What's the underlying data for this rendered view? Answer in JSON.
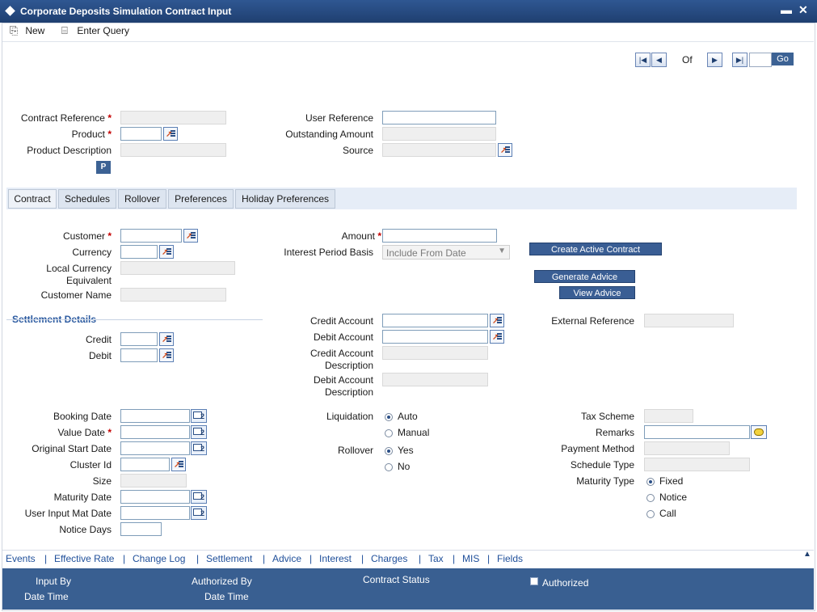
{
  "window": {
    "title": "Corporate Deposits Simulation Contract Input",
    "minimize": "▬",
    "close": "✕"
  },
  "toolbar": {
    "new_label": "New",
    "enter_query_label": "Enter Query"
  },
  "pager": {
    "of_label": "Of",
    "go_label": "Go",
    "first": "|◀",
    "prev": "◀",
    "next": "▶",
    "last": "▶|"
  },
  "header": {
    "contract_reference": "Contract Reference",
    "product": "Product",
    "product_description": "Product Description",
    "p_button": "P",
    "user_reference": "User Reference",
    "outstanding_amount": "Outstanding Amount",
    "source": "Source",
    "required_mark": "*"
  },
  "tabs": [
    {
      "label": "Contract"
    },
    {
      "label": "Schedules"
    },
    {
      "label": "Rollover"
    },
    {
      "label": "Preferences"
    },
    {
      "label": "Holiday Preferences"
    }
  ],
  "contract": {
    "customer": "Customer",
    "currency": "Currency",
    "local_currency_equivalent_1": "Local Currency",
    "local_currency_equivalent_2": "Equivalent",
    "customer_name": "Customer Name",
    "amount": "Amount",
    "interest_period_basis": "Interest Period Basis",
    "interest_period_basis_value": "Include From Date",
    "create_active_contract": "Create Active Contract",
    "generate_advice": "Generate Advice",
    "view_advice": "View Advice"
  },
  "settlement": {
    "title": "Settlement Details",
    "credit": "Credit",
    "debit": "Debit",
    "credit_account": "Credit Account",
    "debit_account": "Debit Account",
    "credit_account_description_1": "Credit Account",
    "credit_account_description_2": "Description",
    "debit_account_description_1": "Debit Account",
    "debit_account_description_2": "Description",
    "external_reference": "External Reference"
  },
  "dates": {
    "booking_date": "Booking Date",
    "value_date": "Value Date",
    "original_start_date": "Original Start Date",
    "cluster_id": "Cluster Id",
    "size": "Size",
    "maturity_date": "Maturity Date",
    "user_input_mat_date": "User Input Mat Date",
    "notice_days": "Notice Days"
  },
  "options": {
    "liquidation": "Liquidation",
    "liquidation_auto": "Auto",
    "liquidation_manual": "Manual",
    "rollover": "Rollover",
    "rollover_yes": "Yes",
    "rollover_no": "No",
    "tax_scheme": "Tax Scheme",
    "remarks": "Remarks",
    "payment_method": "Payment Method",
    "schedule_type": "Schedule Type",
    "maturity_type": "Maturity Type",
    "maturity_fixed": "Fixed",
    "maturity_notice": "Notice",
    "maturity_call": "Call"
  },
  "links": [
    "Events",
    "Effective Rate",
    "Change Log",
    "Settlement",
    "Advice",
    "Interest",
    "Charges",
    "Tax",
    "MIS",
    "Fields"
  ],
  "footer": {
    "input_by": "Input By",
    "date_time_1": "Date Time",
    "authorized_by": "Authorized By",
    "date_time_2": "Date Time",
    "contract_status": "Contract Status",
    "authorized": "Authorized"
  }
}
